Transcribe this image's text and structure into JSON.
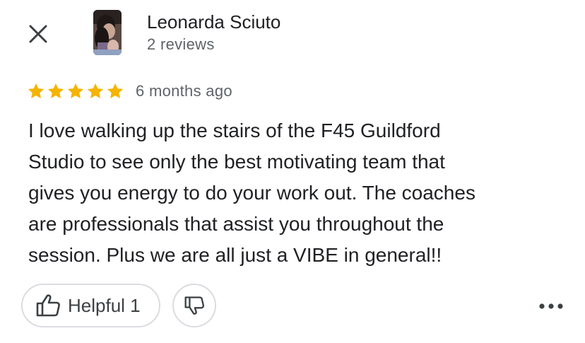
{
  "header": {
    "close_icon": "close-icon"
  },
  "author": {
    "name": "Leonarda Sciuto",
    "reviews": "2 reviews",
    "avatar": "profile-photo"
  },
  "review": {
    "rating": 5,
    "max_rating": 5,
    "star_color": "#f4b400",
    "time_ago": "6 months ago",
    "text": "I love walking up the stairs of the F45 Guildford\nStudio to see only the best motivating team that\ngives you energy to do your work out.  The coaches\nare professionals that assist you throughout the\nsession.  Plus we are all just a VIBE in general!!"
  },
  "actions": {
    "helpful_label": "Helpful 1",
    "helpful_icon": "thumbs-up-icon",
    "dislike_icon": "thumbs-down-icon",
    "more_icon": "more-horizontal-icon"
  }
}
